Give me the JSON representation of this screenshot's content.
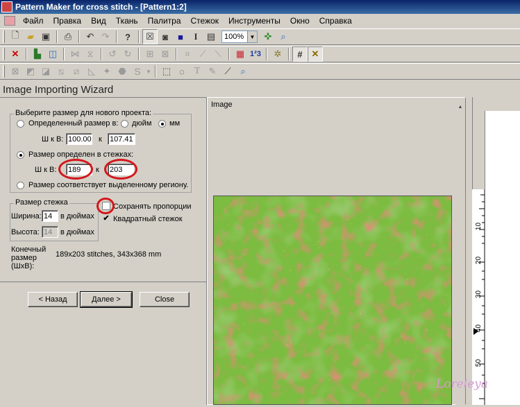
{
  "window": {
    "title": "Pattern Maker for cross stitch - [Pattern1:2]"
  },
  "menu": [
    "Файл",
    "Правка",
    "Вид",
    "Ткань",
    "Палитра",
    "Стежок",
    "Инструменты",
    "Окно",
    "Справка"
  ],
  "toolbar": {
    "zoom_value": "100%"
  },
  "wizard": {
    "title": "Image Importing Wizard",
    "size_group_label": "Выберите размер для нового проекта:",
    "option_defined_size": "Определенный размер в:",
    "unit_inch": "дюйм",
    "unit_mm": "мм",
    "wxh_label_1": "Ш к В:",
    "width_value": "100.00",
    "x_label_1": "к",
    "height_value": "107.41",
    "option_stitches": "Размер определен в стежках:",
    "wxh_label_2": "Ш к В:",
    "stitch_width": "189",
    "x_label_2": "к",
    "stitch_height": "203",
    "option_region": "Размер соответствует выделенному региону.",
    "stitch_group_label": "Размер стежка",
    "width_label": "Ширина:",
    "width_stitch": "14",
    "width_unit": "в дюймах",
    "height_label": "Высота:",
    "height_stitch": "14",
    "height_unit": "в дюймах",
    "keep_ratio": "Сохранять пропорции",
    "square_stitch": "Квадратный стежок",
    "final_size_label": "Конечный размер (ШхВ):",
    "final_size_value": "189x203 stitches,  343x368 mm",
    "back_button": "< Назад",
    "next_button": "Далее >",
    "close_button": "Close",
    "selected_size_option": "stitches",
    "selected_unit": "mm",
    "keep_ratio_checked": false,
    "square_stitch_checked": true
  },
  "image_panel": {
    "title": "Image"
  },
  "ruler": {
    "labels": [
      "10",
      "20",
      "30",
      "40",
      "50"
    ]
  },
  "watermark": "Loreleya",
  "colors": {
    "titlebar": "#0a246a",
    "highlight_circle": "#d4161b",
    "image_green": "#72b33c",
    "image_red": "#b5442e"
  }
}
